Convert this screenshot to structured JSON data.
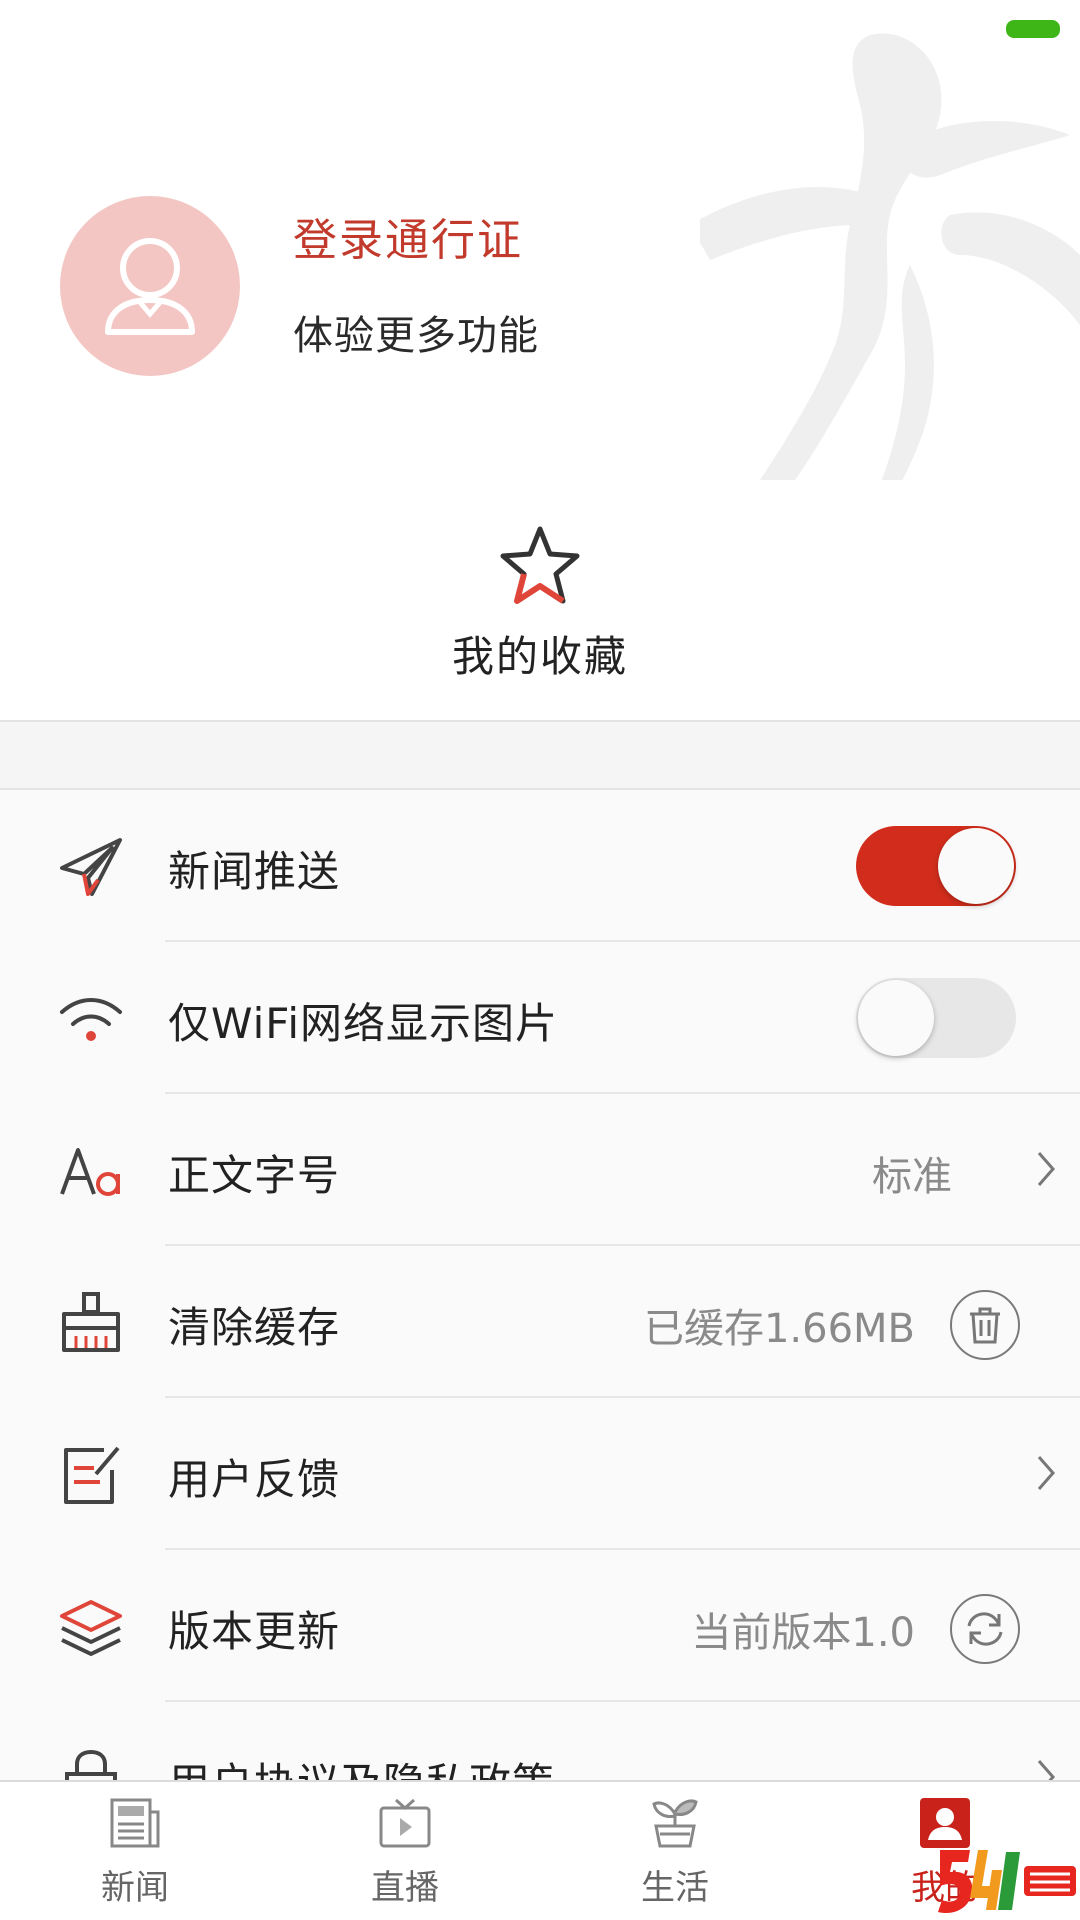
{
  "status_bar": {
    "battery_color": "#3fb618"
  },
  "profile": {
    "login_title": "登录通行证",
    "login_subtitle": "体验更多功能",
    "avatar_icon": "user-outline-icon"
  },
  "favorites": {
    "label": "我的收藏",
    "icon": "star-icon"
  },
  "settings": {
    "items": [
      {
        "label": "新闻推送",
        "icon": "paper-plane-icon",
        "control": "toggle",
        "toggle_on": true
      },
      {
        "label": "仅WiFi网络显示图片",
        "icon": "wifi-icon",
        "control": "toggle",
        "toggle_on": false
      },
      {
        "label": "正文字号",
        "icon": "font-size-icon",
        "value": "标准",
        "control": "chevron"
      },
      {
        "label": "清除缓存",
        "icon": "broom-icon",
        "value": "已缓存1.66MB",
        "control": "trash-button"
      },
      {
        "label": "用户反馈",
        "icon": "feedback-icon",
        "control": "chevron"
      },
      {
        "label": "版本更新",
        "icon": "layers-icon",
        "value": "当前版本1.0",
        "control": "refresh-button"
      },
      {
        "label": "用户协议及隐私政策",
        "icon": "lock-icon",
        "control": "chevron"
      }
    ]
  },
  "tabbar": {
    "tabs": [
      {
        "label": "新闻",
        "icon": "newspaper-icon",
        "active": false
      },
      {
        "label": "直播",
        "icon": "tv-play-icon",
        "active": false
      },
      {
        "label": "生活",
        "icon": "sprout-icon",
        "active": false
      },
      {
        "label": "我的",
        "icon": "profile-icon",
        "active": true
      }
    ]
  },
  "colors": {
    "accent": "#c8221b",
    "toggle_on": "#d22d1c",
    "avatar_bg": "#f3c6c3",
    "title_red": "#c23a2b"
  }
}
